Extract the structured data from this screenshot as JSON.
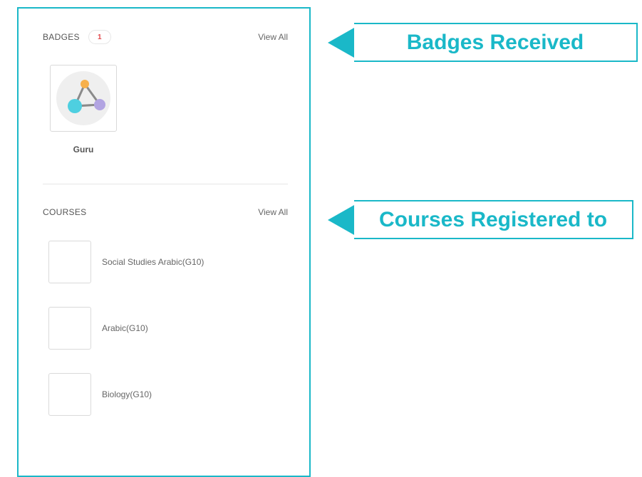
{
  "badges": {
    "title": "BADGES",
    "count": "1",
    "view_all": "View All",
    "items": [
      {
        "name": "Guru",
        "icon": "guru-network-icon"
      }
    ]
  },
  "courses": {
    "title": "COURSES",
    "view_all": "View All",
    "items": [
      {
        "name": "Social Studies Arabic(G10)"
      },
      {
        "name": "Arabic(G10)"
      },
      {
        "name": "Biology(G10)"
      }
    ]
  },
  "callouts": {
    "badges": "Badges Received",
    "courses": "Courses Registered to"
  },
  "colors": {
    "accent": "#1ab8c8",
    "badge_count": "#e2474b",
    "node_orange": "#f7b04b",
    "node_cyan": "#4ecfe0",
    "node_purple": "#b2a4e2"
  }
}
